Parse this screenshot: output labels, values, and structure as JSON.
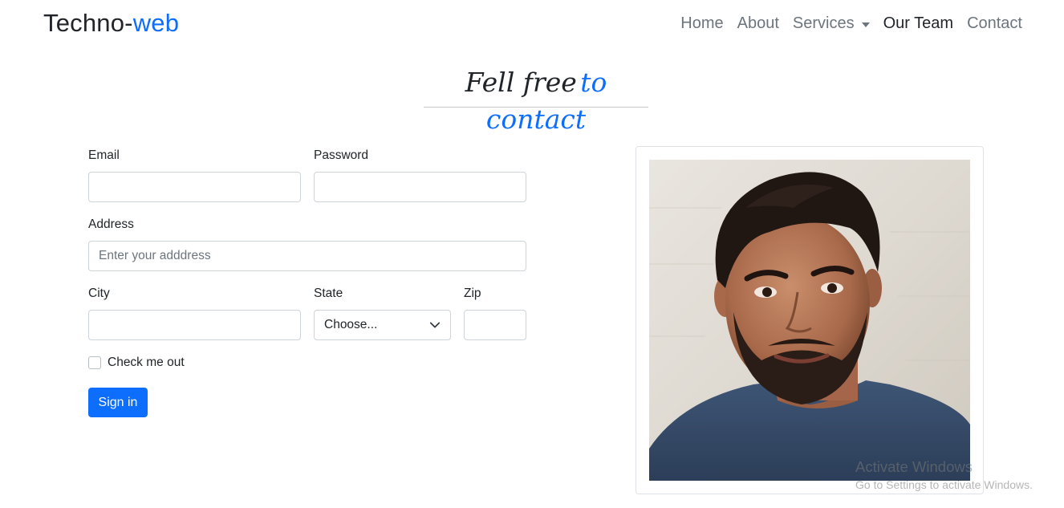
{
  "navbar": {
    "brand_main": "Techno-",
    "brand_accent": "web",
    "links": [
      {
        "label": "Home"
      },
      {
        "label": "About"
      },
      {
        "label": "Services"
      },
      {
        "label": "Our Team"
      },
      {
        "label": "Contact"
      }
    ]
  },
  "heading": {
    "part1": "Fell free",
    "part2": "to contact"
  },
  "form": {
    "email_label": "Email",
    "email_value": "",
    "password_label": "Password",
    "password_value": "",
    "address_label": "Address",
    "address_placeholder": "Enter your adddress",
    "city_label": "City",
    "city_value": "",
    "state_label": "State",
    "state_selected": "Choose...",
    "zip_label": "Zip",
    "zip_value": "",
    "checkbox_label": "Check me out",
    "checkbox_checked": false,
    "submit_label": "Sign in"
  },
  "watermark": {
    "title": "Activate Windows",
    "subtitle": "Go to Settings to activate Windows."
  },
  "colors": {
    "accent": "#0d6efd",
    "text": "#212529",
    "muted": "#6c757d",
    "border": "#ced4da"
  }
}
